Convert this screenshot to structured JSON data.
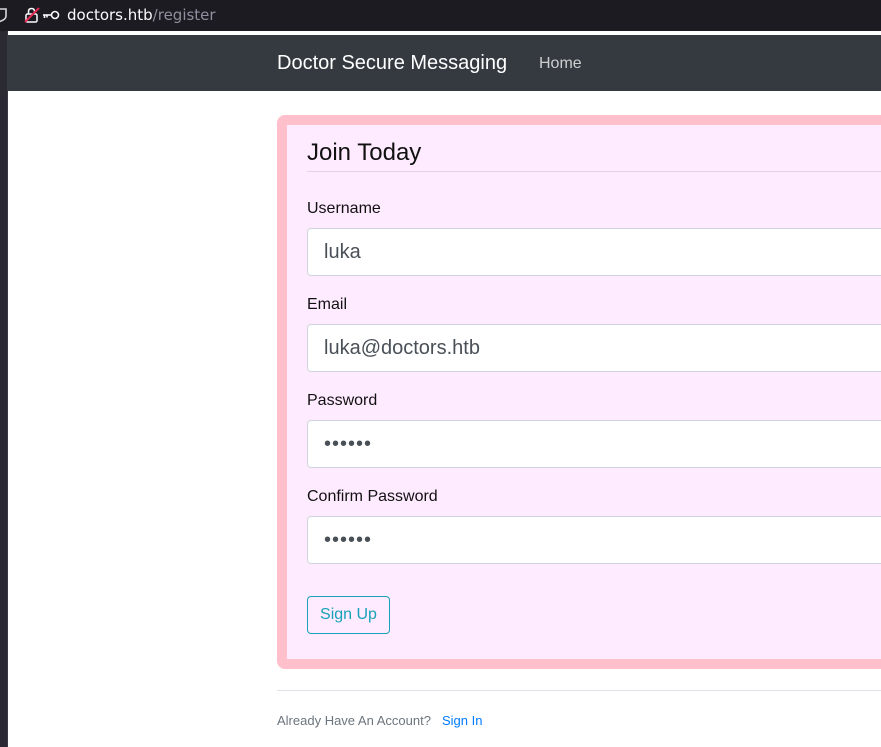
{
  "browser": {
    "url_domain": "doctors.htb",
    "url_path": "/register"
  },
  "navbar": {
    "brand": "Doctor Secure Messaging",
    "home": "Home"
  },
  "form": {
    "legend": "Join Today",
    "username": {
      "label": "Username",
      "value": "luka"
    },
    "email": {
      "label": "Email",
      "value": "luka@doctors.htb"
    },
    "password": {
      "label": "Password",
      "value": "••••••"
    },
    "confirm_password": {
      "label": "Confirm Password",
      "value": "••••••"
    },
    "submit": "Sign Up"
  },
  "footer": {
    "text": "Already Have An Account?",
    "link": "Sign In"
  },
  "colors": {
    "card_border": "#ffc0cb",
    "card_background": "#ffebff",
    "navbar": "#343a40",
    "button_outline": "#17a2b8",
    "link": "#007bff"
  }
}
